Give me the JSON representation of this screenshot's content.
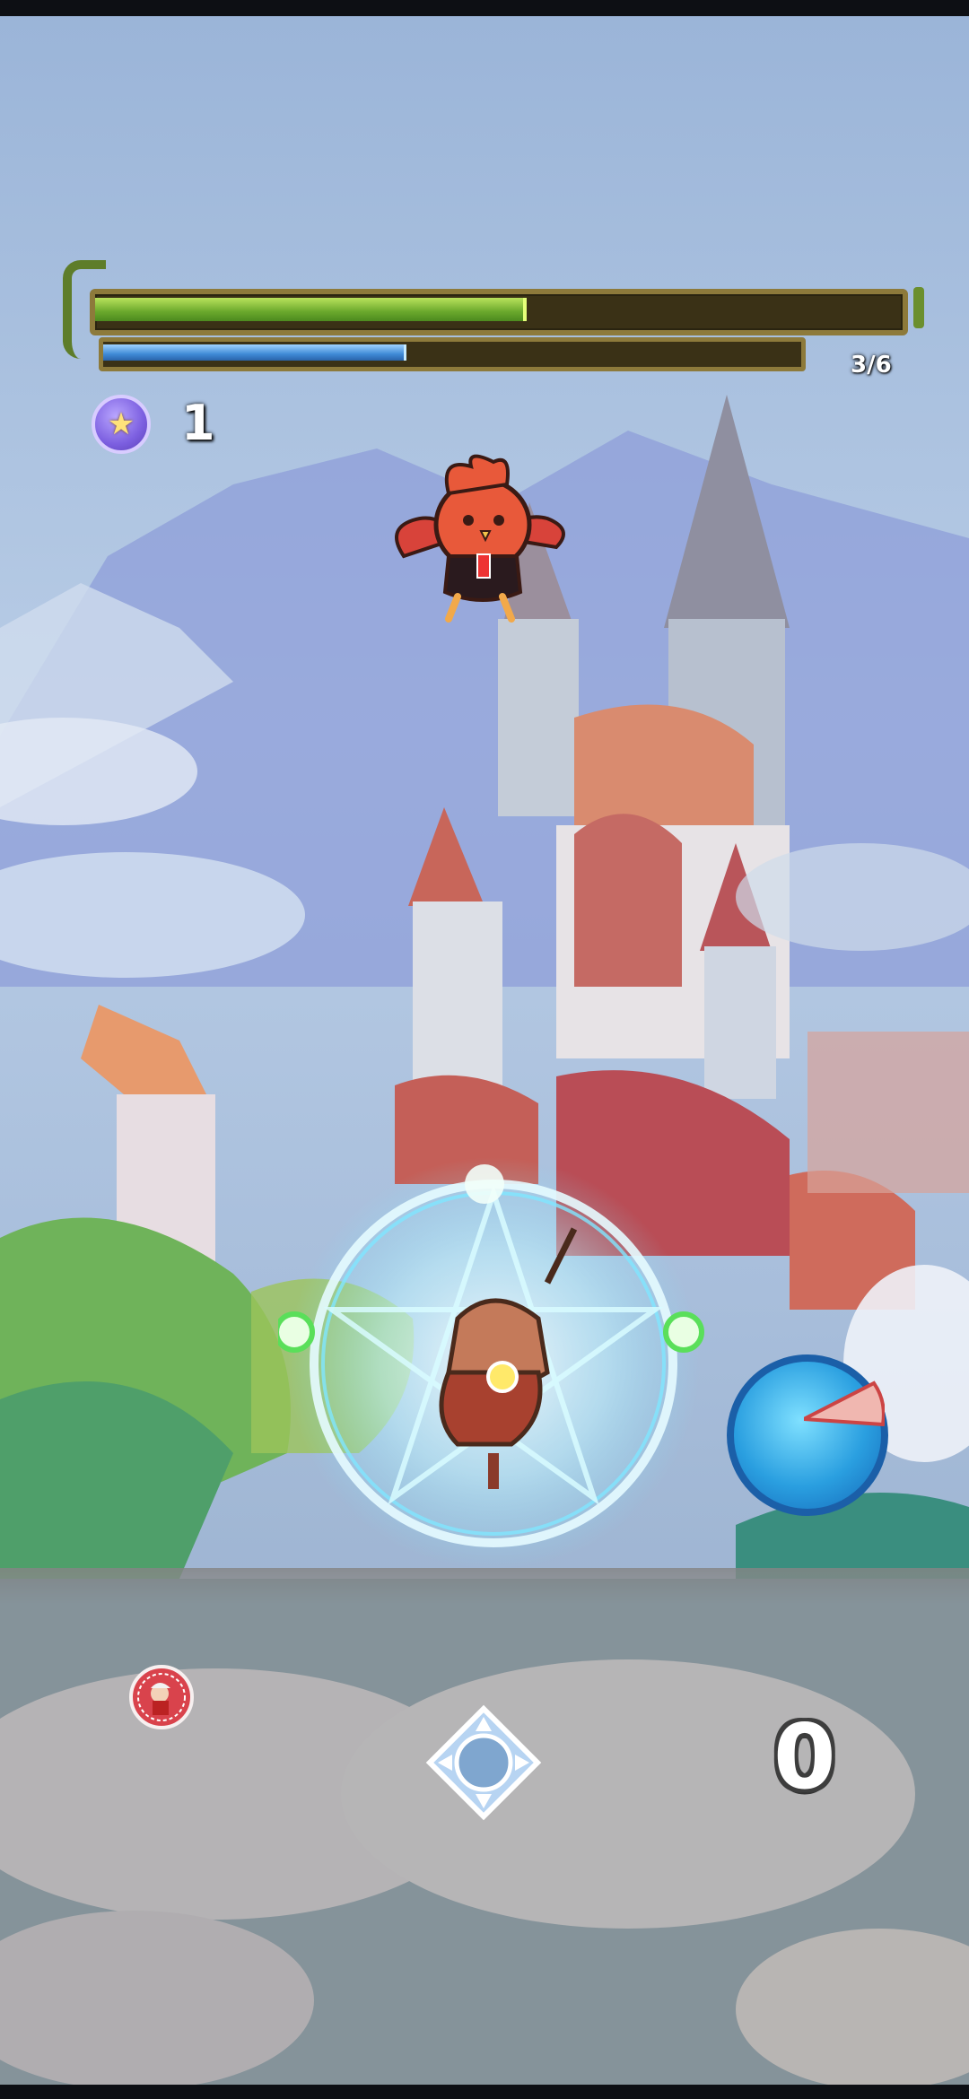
{
  "hud": {
    "health_fraction": 0.53,
    "mana_fraction": 0.43,
    "wave_counter": "3/6",
    "token_icon": "star-token-icon",
    "token_count": "1"
  },
  "skill": {
    "icon": "skill-cooldown-icon",
    "cooldown_fraction": 0.12
  },
  "controls": {
    "avatar_icon": "character-avatar-icon",
    "move_icon": "directional-move-icon",
    "score": "0"
  },
  "colors": {
    "health": "#6aa82c",
    "mana": "#3f8ad6",
    "skill": "#2a9fe0",
    "token": "#7c5fe0"
  }
}
